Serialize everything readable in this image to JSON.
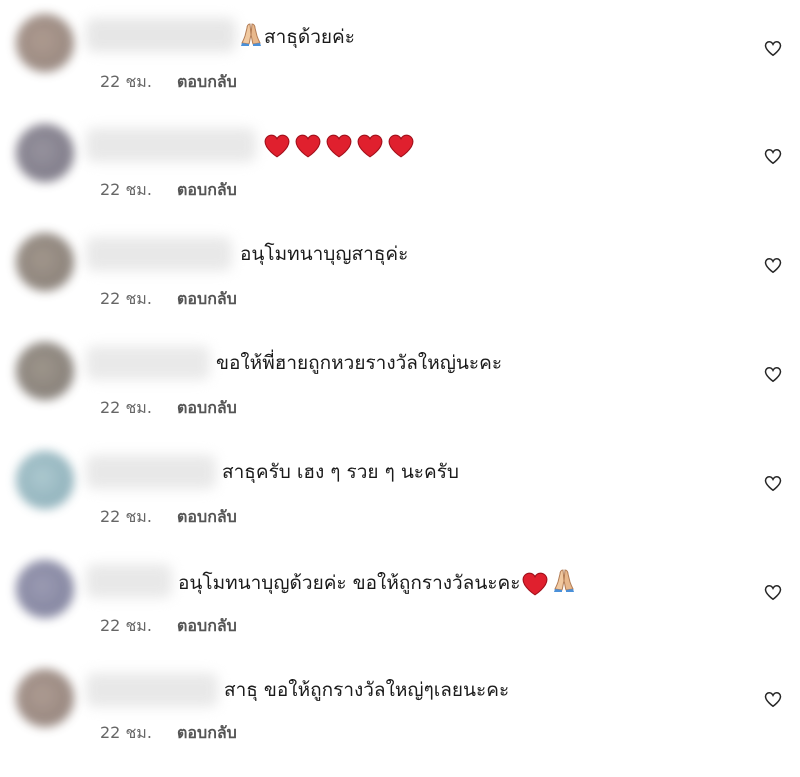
{
  "comments": [
    {
      "text": "สาธุด้วยค่ะ",
      "time": "22 ชม.",
      "reply": "ตอบกลับ",
      "lead_emoji": "folded-hands",
      "trail_hearts": 0
    },
    {
      "text": "",
      "time": "22 ชม.",
      "reply": "ตอบกลับ",
      "lead_emoji": "",
      "trail_hearts": 5
    },
    {
      "text": "อนุโมทนาบุญสาธุค่ะ",
      "time": "22 ชม.",
      "reply": "ตอบกลับ",
      "lead_emoji": "",
      "trail_hearts": 0
    },
    {
      "text": "ขอให้พี่ฮายถูกหวยรางวัลใหญ่นะคะ",
      "time": "22 ชม.",
      "reply": "ตอบกลับ",
      "lead_emoji": "",
      "trail_hearts": 0
    },
    {
      "text": "สาธุครับ เฮง ๆ รวย ๆ นะครับ",
      "time": "22 ชม.",
      "reply": "ตอบกลับ",
      "lead_emoji": "",
      "trail_hearts": 0
    },
    {
      "text": "อนุโมทนาบุญด้วยค่ะ ขอให้ถูกรางวัลนะคะ",
      "time": "22 ชม.",
      "reply": "ตอบกลับ",
      "lead_emoji": "",
      "trail_hearts": 1,
      "trail_emoji": "folded-hands"
    },
    {
      "text": "สาธุ ขอให้ถูกรางวัลใหญ่ๆเลยนะคะ",
      "time": "22 ชม.",
      "reply": "ตอบกลับ",
      "lead_emoji": "",
      "trail_hearts": 0
    }
  ],
  "icons": {
    "like": "heart-outline-icon",
    "heart_emoji": "red-heart-icon",
    "hands_emoji": "folded-hands-icon"
  },
  "colors": {
    "text": "#1a1a1a",
    "meta": "#666666",
    "heart_emoji": "#e0202e"
  }
}
